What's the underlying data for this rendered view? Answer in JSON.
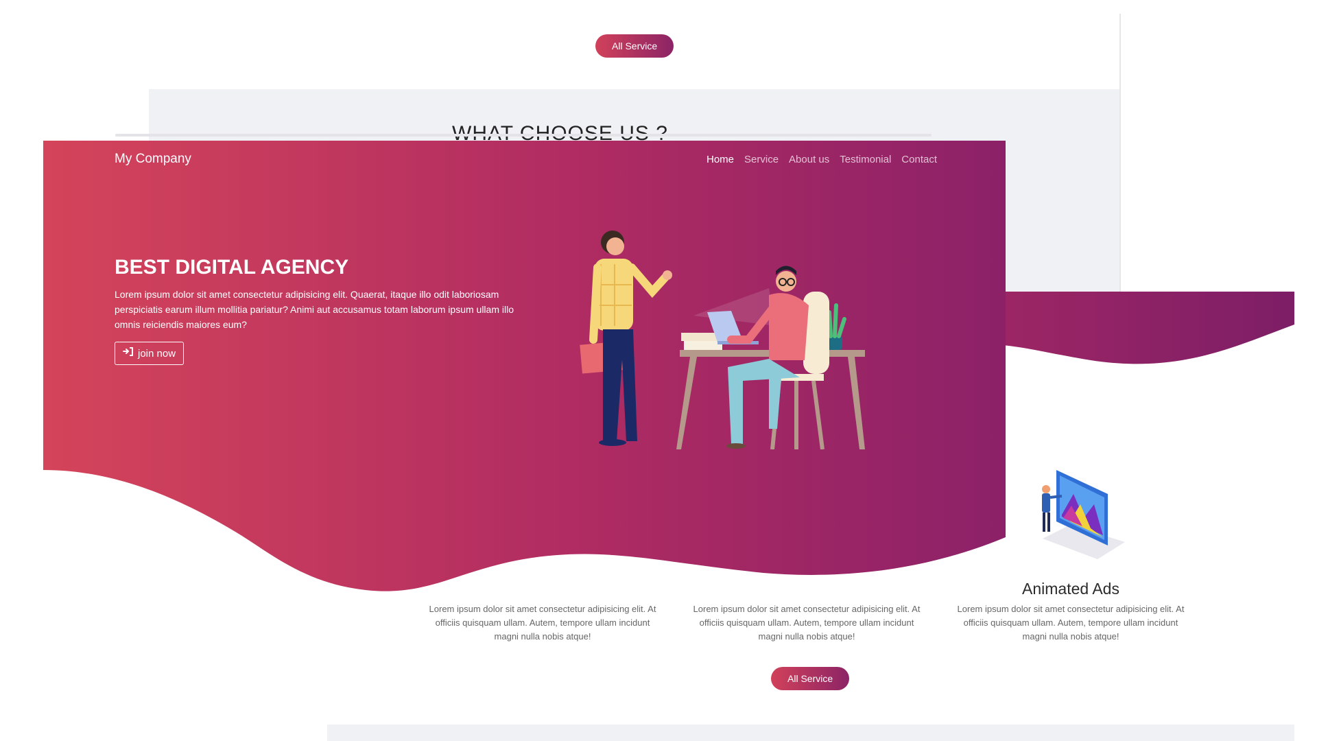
{
  "back_top": {
    "all_service_button": "All Service",
    "section_heading": "WHAT CHOOSE US ?"
  },
  "services": [
    {
      "title": "",
      "text": "Lorem ipsum dolor sit amet consectetur adipisicing elit. At officiis quisquam ullam. Autem, tempore ullam incidunt magni nulla nobis atque!"
    },
    {
      "title": "",
      "text": "Lorem ipsum dolor sit amet consectetur adipisicing elit. At officiis quisquam ullam. Autem, tempore ullam incidunt magni nulla nobis atque!"
    },
    {
      "title": "Animated Ads",
      "text": "Lorem ipsum dolor sit amet consectetur adipisicing elit. At officiis quisquam ullam. Autem, tempore ullam incidunt magni nulla nobis atque!"
    }
  ],
  "back_bottom": {
    "all_service_button": "All Service"
  },
  "hero": {
    "brand": "My Company",
    "nav": [
      "Home",
      "Service",
      "About us",
      "Testimonial",
      "Contact"
    ],
    "active_nav": "Home",
    "title": "BEST DIGITAL AGENCY",
    "text": "Lorem ipsum dolor sit amet consectetur adipisicing elit. Quaerat, itaque illo odit laboriosam perspiciatis earum illum mollitia pariatur? Animi aut accusamus totam laborum ipsum ullam illo omnis reiciendis maiores eum?",
    "join_button": "join now"
  },
  "colors": {
    "gradient_start": "#d1415a",
    "gradient_end": "#8c2466",
    "section_gray": "#f0f1f5"
  }
}
